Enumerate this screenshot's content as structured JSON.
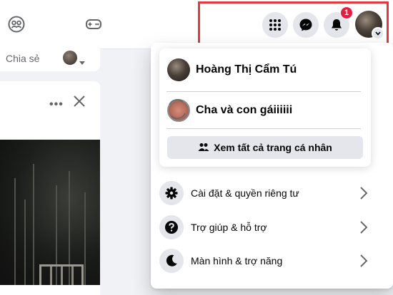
{
  "nav": {
    "notification_count": "1"
  },
  "share_bar": {
    "share_label": "Chia sẻ"
  },
  "post": {
    "more_label": "•••"
  },
  "account_menu": {
    "profile_name": "Hoàng Thị Cẩm Tú",
    "page_name": "Cha và con gáiiiiii",
    "see_all_label": "Xem tất cả trang cá nhân",
    "items": [
      {
        "label": "Cài đặt & quyền riêng tư",
        "icon": "gear-icon"
      },
      {
        "label": "Trợ giúp & hỗ trợ",
        "icon": "help-icon"
      },
      {
        "label": "Màn hình & trợ năng",
        "icon": "moon-icon"
      }
    ]
  },
  "colors": {
    "highlight": "#e53935",
    "badge": "#e41e3f",
    "icon_bg": "#e4e6eb"
  }
}
